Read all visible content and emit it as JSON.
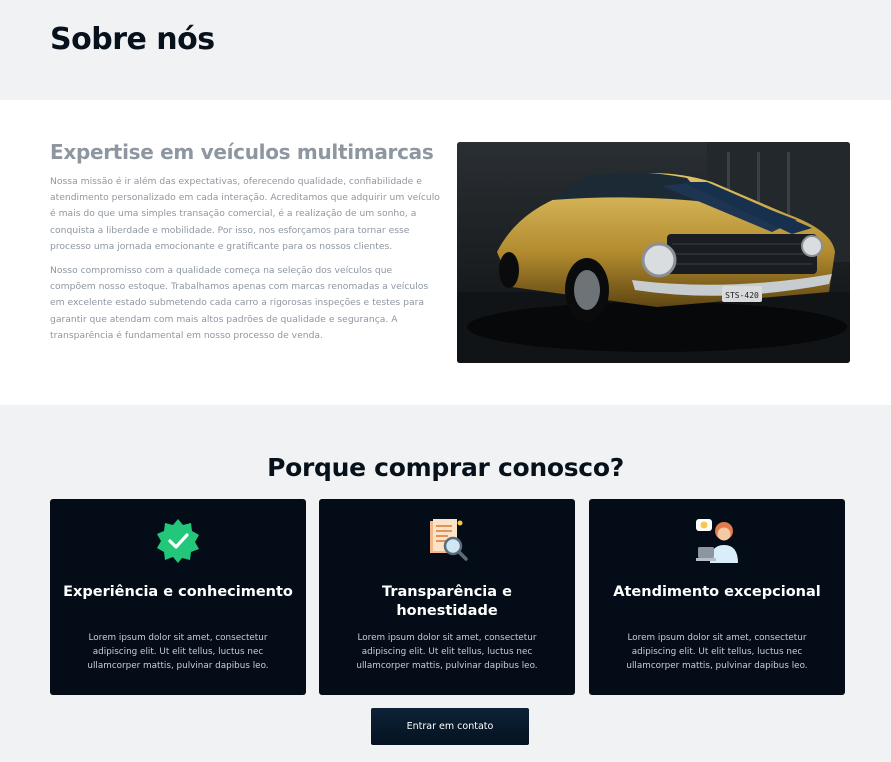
{
  "header": {
    "title": "Sobre nós"
  },
  "about": {
    "heading": "Expertise em veículos multimarcas",
    "paragraphs": [
      "Nossa missão é ir além das expectativas, oferecendo qualidade, confiabilidade e atendimento personalizado em cada interação. Acreditamos que adquirir um veículo é mais do que uma simples transação comercial, é a realização de um sonho, a conquista a liberdade e mobilidade. Por isso, nos esforçamos para tornar esse processo uma jornada emocionante e gratificante para os nossos clientes.",
      "Nosso compromisso com a qualidade começa na seleção dos veículos que compõem nosso estoque. Trabalhamos apenas com marcas renomadas a veículos em excelente estado submetendo cada carro a rigorosas inspeções e testes para garantir que atendam com mais altos padrões de qualidade e segurança. A transparência é fundamental em nosso processo de venda."
    ],
    "image": {
      "icon": "car-photo",
      "plate": "STS-420"
    }
  },
  "why": {
    "title": "Porque comprar conosco?",
    "cards": [
      {
        "icon": "verified-badge-icon",
        "title": "Experiência e conhecimento",
        "text": "Lorem ipsum dolor sit amet, consectetur adipiscing elit. Ut elit tellus, luctus nec ullamcorper mattis, pulvinar dapibus leo."
      },
      {
        "icon": "document-search-icon",
        "title": "Transparência e honestidade",
        "text": "Lorem ipsum dolor sit amet, consectetur adipiscing elit. Ut elit tellus, luctus nec ullamcorper mattis, pulvinar dapibus leo."
      },
      {
        "icon": "support-agent-icon",
        "title": "Atendimento excepcional",
        "text": "Lorem ipsum dolor sit amet, consectetur adipiscing elit. Ut elit tellus, luctus nec ullamcorper mattis, pulvinar dapibus leo."
      }
    ],
    "cta_label": "Entrar em contato"
  },
  "colors": {
    "card_bg": "#040d17",
    "badge_green": "#22c77a",
    "page_bg": "#f1f2f4"
  }
}
